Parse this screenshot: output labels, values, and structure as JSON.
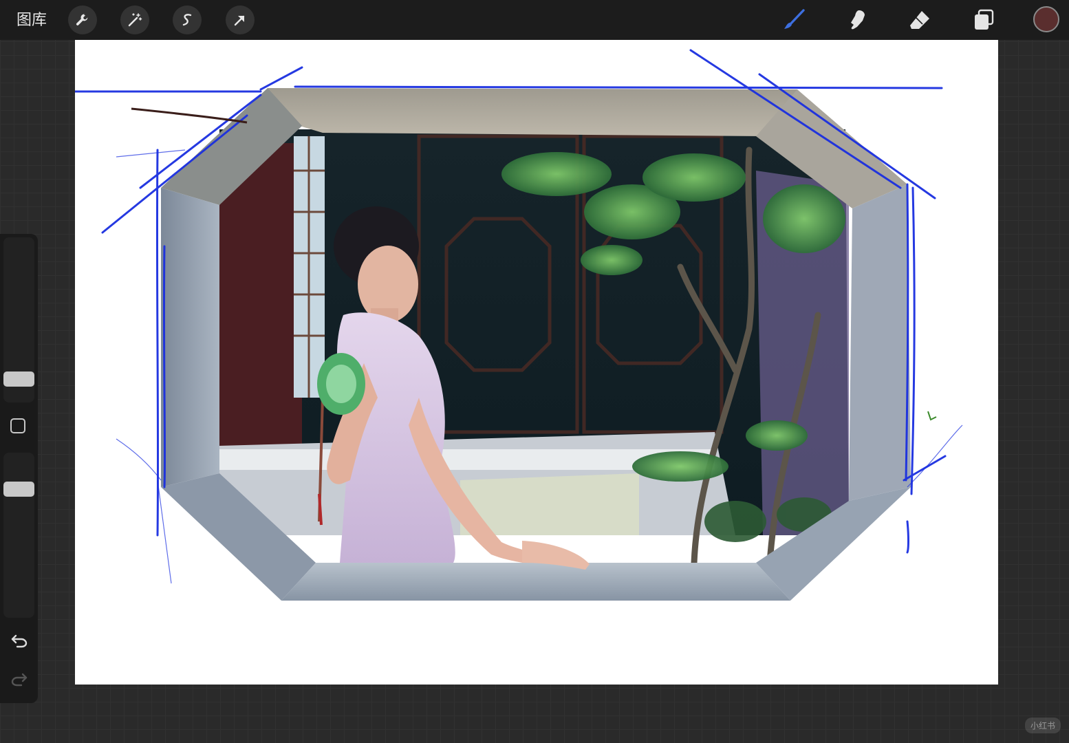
{
  "toolbar": {
    "gallery_label": "图库",
    "left_tools": [
      {
        "name": "actions",
        "icon": "wrench-icon"
      },
      {
        "name": "adjustments",
        "icon": "magic-wand-icon"
      },
      {
        "name": "selection",
        "icon": "selection-s-icon"
      },
      {
        "name": "transform",
        "icon": "arrow-cursor-icon"
      }
    ],
    "right_tools": [
      {
        "name": "brush",
        "icon": "brush-icon",
        "active": true
      },
      {
        "name": "smudge",
        "icon": "smudge-icon"
      },
      {
        "name": "eraser",
        "icon": "eraser-icon"
      },
      {
        "name": "layers",
        "icon": "layers-icon"
      }
    ],
    "active_color": "#5a2e2e",
    "accent_color": "#3d6fe0"
  },
  "sidebar": {
    "brush_size_level": 0.31,
    "opacity_level": 0.84,
    "modify_button_icon": "square-icon",
    "undo_icon": "undo-icon",
    "redo_icon": "redo-icon"
  },
  "canvas": {
    "background": "#ffffff",
    "artwork_icon": "painting-artwork"
  },
  "watermark": "小红书"
}
